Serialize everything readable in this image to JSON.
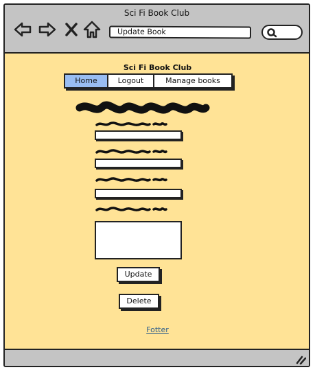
{
  "window": {
    "title": "Sci Fi Book Club"
  },
  "browser": {
    "address": "Update Book",
    "icons": [
      "back-arrow-icon",
      "forward-arrow-icon",
      "close-x-icon",
      "home-icon",
      "search-icon",
      "resize-handle-icon"
    ]
  },
  "page": {
    "site_title": "Sci Fi Book Club",
    "nav": [
      {
        "label": "Home",
        "active": true
      },
      {
        "label": "Logout",
        "active": false
      },
      {
        "label": "Manage books",
        "active": false
      }
    ],
    "buttons": {
      "update": "Update",
      "delete": "Delete"
    },
    "footer": "Fotter"
  },
  "colors": {
    "content_bg": "#ffe396",
    "chrome": "#c4c4c4",
    "nav_active": "#99bdf2",
    "link": "#2a5c8a"
  }
}
